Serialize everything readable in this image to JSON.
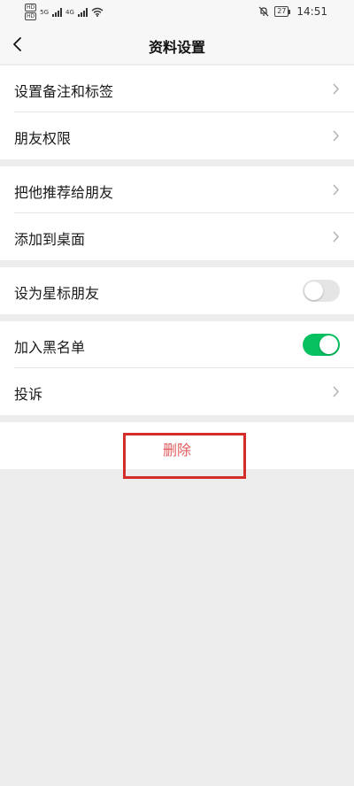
{
  "status_bar": {
    "time": "14:51",
    "battery": "27",
    "hd1": "HD",
    "hd2": "HD",
    "sig1": "5G",
    "sig2": "4G"
  },
  "nav": {
    "title": "资料设置",
    "back_icon": "chevron-left-icon"
  },
  "groups": [
    {
      "items": [
        {
          "label": "设置备注和标签",
          "accessory": "chevron"
        },
        {
          "label": "朋友权限",
          "accessory": "chevron"
        }
      ]
    },
    {
      "items": [
        {
          "label": "把他推荐给朋友",
          "accessory": "chevron"
        },
        {
          "label": "添加到桌面",
          "accessory": "chevron"
        }
      ]
    },
    {
      "items": [
        {
          "label": "设为星标朋友",
          "accessory": "toggle",
          "on": false
        }
      ]
    },
    {
      "items": [
        {
          "label": "加入黑名单",
          "accessory": "toggle",
          "on": true
        },
        {
          "label": "投诉",
          "accessory": "chevron"
        }
      ]
    }
  ],
  "delete_button": {
    "label": "删除"
  },
  "colors": {
    "accent_green": "#07c160",
    "highlight_red": "#d42b2b",
    "delete_text": "#e05a5a",
    "background": "#ededed"
  }
}
